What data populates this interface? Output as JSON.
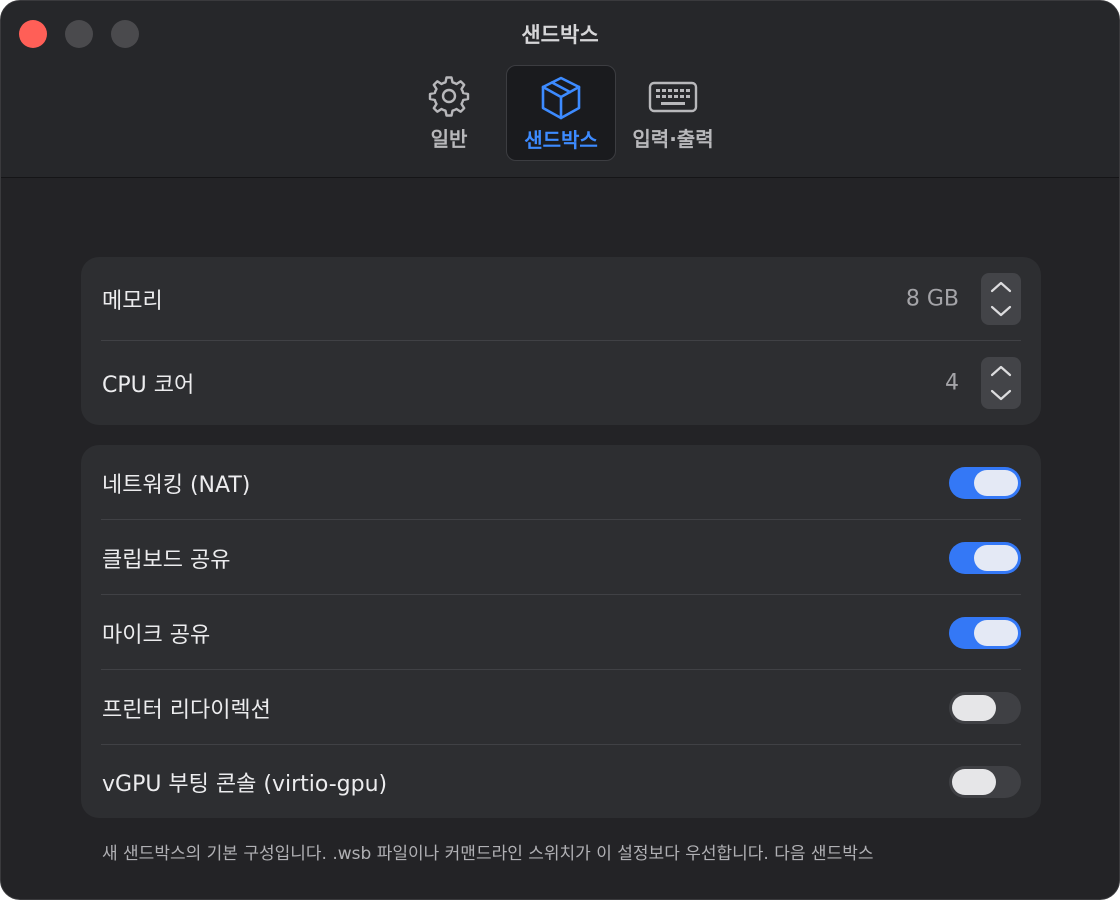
{
  "window": {
    "title": "샌드박스",
    "traffic_lights": [
      "close-button",
      "minimize-button",
      "zoom-button"
    ]
  },
  "tabs": [
    {
      "label": "일반",
      "icon": "gear-icon",
      "selected": false
    },
    {
      "label": "샌드박스",
      "icon": "box-icon",
      "selected": true
    },
    {
      "label": "입력·출력",
      "icon": "keyboard-icon",
      "selected": false
    }
  ],
  "resources": {
    "memory": {
      "label": "메모리",
      "value": "8 GB"
    },
    "cpu": {
      "label": "CPU 코어",
      "value": "4"
    }
  },
  "toggles": [
    {
      "label": "네트워킹 (NAT)",
      "on": true
    },
    {
      "label": "클립보드 공유",
      "on": true
    },
    {
      "label": "마이크 공유",
      "on": true
    },
    {
      "label": "프린터 리다이렉션",
      "on": false
    },
    {
      "label": "vGPU 부팅 콘솔 (virtio-gpu)",
      "on": false
    }
  ],
  "footnote": "새 샌드박스의 기본 구성입니다. .wsb 파일이나 커맨드라인 스위치가 이 설정보다 우선합니다. 다음 샌드박스",
  "colors": {
    "accent": "#3478f6",
    "tab_selected_text": "#3d8bff",
    "window_bg": "#232326",
    "group_bg": "#2d2e31",
    "close": "#ff5f57"
  }
}
